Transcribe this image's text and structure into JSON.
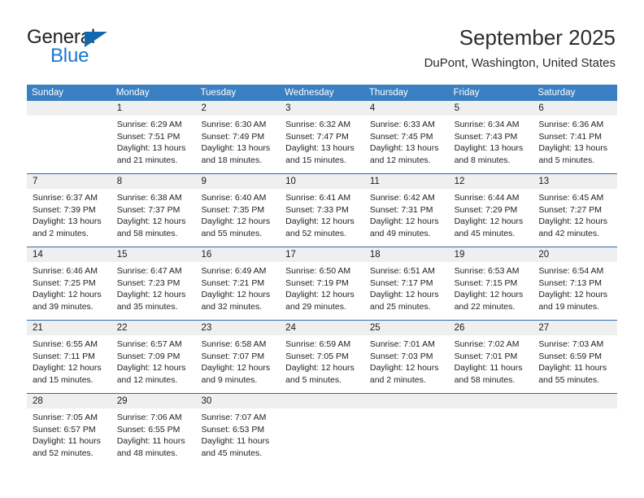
{
  "brand": {
    "name_top": "General",
    "name_bottom": "Blue",
    "accent_color": "#1878cf",
    "triangle_color": "#1267b1"
  },
  "header": {
    "title": "September 2025",
    "subtitle": "DuPont, Washington, United States"
  },
  "theme": {
    "header_row_bg": "#3a7fc1",
    "week_divider": "#2c6ca8",
    "day_number_band": "#efefef"
  },
  "calendar": {
    "weekdays": [
      "Sunday",
      "Monday",
      "Tuesday",
      "Wednesday",
      "Thursday",
      "Friday",
      "Saturday"
    ],
    "weeks": [
      [
        {
          "day": "",
          "lines": []
        },
        {
          "day": "1",
          "lines": [
            "Sunrise: 6:29 AM",
            "Sunset: 7:51 PM",
            "Daylight: 13 hours",
            "and 21 minutes."
          ]
        },
        {
          "day": "2",
          "lines": [
            "Sunrise: 6:30 AM",
            "Sunset: 7:49 PM",
            "Daylight: 13 hours",
            "and 18 minutes."
          ]
        },
        {
          "day": "3",
          "lines": [
            "Sunrise: 6:32 AM",
            "Sunset: 7:47 PM",
            "Daylight: 13 hours",
            "and 15 minutes."
          ]
        },
        {
          "day": "4",
          "lines": [
            "Sunrise: 6:33 AM",
            "Sunset: 7:45 PM",
            "Daylight: 13 hours",
            "and 12 minutes."
          ]
        },
        {
          "day": "5",
          "lines": [
            "Sunrise: 6:34 AM",
            "Sunset: 7:43 PM",
            "Daylight: 13 hours",
            "and 8 minutes."
          ]
        },
        {
          "day": "6",
          "lines": [
            "Sunrise: 6:36 AM",
            "Sunset: 7:41 PM",
            "Daylight: 13 hours",
            "and 5 minutes."
          ]
        }
      ],
      [
        {
          "day": "7",
          "lines": [
            "Sunrise: 6:37 AM",
            "Sunset: 7:39 PM",
            "Daylight: 13 hours",
            "and 2 minutes."
          ]
        },
        {
          "day": "8",
          "lines": [
            "Sunrise: 6:38 AM",
            "Sunset: 7:37 PM",
            "Daylight: 12 hours",
            "and 58 minutes."
          ]
        },
        {
          "day": "9",
          "lines": [
            "Sunrise: 6:40 AM",
            "Sunset: 7:35 PM",
            "Daylight: 12 hours",
            "and 55 minutes."
          ]
        },
        {
          "day": "10",
          "lines": [
            "Sunrise: 6:41 AM",
            "Sunset: 7:33 PM",
            "Daylight: 12 hours",
            "and 52 minutes."
          ]
        },
        {
          "day": "11",
          "lines": [
            "Sunrise: 6:42 AM",
            "Sunset: 7:31 PM",
            "Daylight: 12 hours",
            "and 49 minutes."
          ]
        },
        {
          "day": "12",
          "lines": [
            "Sunrise: 6:44 AM",
            "Sunset: 7:29 PM",
            "Daylight: 12 hours",
            "and 45 minutes."
          ]
        },
        {
          "day": "13",
          "lines": [
            "Sunrise: 6:45 AM",
            "Sunset: 7:27 PM",
            "Daylight: 12 hours",
            "and 42 minutes."
          ]
        }
      ],
      [
        {
          "day": "14",
          "lines": [
            "Sunrise: 6:46 AM",
            "Sunset: 7:25 PM",
            "Daylight: 12 hours",
            "and 39 minutes."
          ]
        },
        {
          "day": "15",
          "lines": [
            "Sunrise: 6:47 AM",
            "Sunset: 7:23 PM",
            "Daylight: 12 hours",
            "and 35 minutes."
          ]
        },
        {
          "day": "16",
          "lines": [
            "Sunrise: 6:49 AM",
            "Sunset: 7:21 PM",
            "Daylight: 12 hours",
            "and 32 minutes."
          ]
        },
        {
          "day": "17",
          "lines": [
            "Sunrise: 6:50 AM",
            "Sunset: 7:19 PM",
            "Daylight: 12 hours",
            "and 29 minutes."
          ]
        },
        {
          "day": "18",
          "lines": [
            "Sunrise: 6:51 AM",
            "Sunset: 7:17 PM",
            "Daylight: 12 hours",
            "and 25 minutes."
          ]
        },
        {
          "day": "19",
          "lines": [
            "Sunrise: 6:53 AM",
            "Sunset: 7:15 PM",
            "Daylight: 12 hours",
            "and 22 minutes."
          ]
        },
        {
          "day": "20",
          "lines": [
            "Sunrise: 6:54 AM",
            "Sunset: 7:13 PM",
            "Daylight: 12 hours",
            "and 19 minutes."
          ]
        }
      ],
      [
        {
          "day": "21",
          "lines": [
            "Sunrise: 6:55 AM",
            "Sunset: 7:11 PM",
            "Daylight: 12 hours",
            "and 15 minutes."
          ]
        },
        {
          "day": "22",
          "lines": [
            "Sunrise: 6:57 AM",
            "Sunset: 7:09 PM",
            "Daylight: 12 hours",
            "and 12 minutes."
          ]
        },
        {
          "day": "23",
          "lines": [
            "Sunrise: 6:58 AM",
            "Sunset: 7:07 PM",
            "Daylight: 12 hours",
            "and 9 minutes."
          ]
        },
        {
          "day": "24",
          "lines": [
            "Sunrise: 6:59 AM",
            "Sunset: 7:05 PM",
            "Daylight: 12 hours",
            "and 5 minutes."
          ]
        },
        {
          "day": "25",
          "lines": [
            "Sunrise: 7:01 AM",
            "Sunset: 7:03 PM",
            "Daylight: 12 hours",
            "and 2 minutes."
          ]
        },
        {
          "day": "26",
          "lines": [
            "Sunrise: 7:02 AM",
            "Sunset: 7:01 PM",
            "Daylight: 11 hours",
            "and 58 minutes."
          ]
        },
        {
          "day": "27",
          "lines": [
            "Sunrise: 7:03 AM",
            "Sunset: 6:59 PM",
            "Daylight: 11 hours",
            "and 55 minutes."
          ]
        }
      ],
      [
        {
          "day": "28",
          "lines": [
            "Sunrise: 7:05 AM",
            "Sunset: 6:57 PM",
            "Daylight: 11 hours",
            "and 52 minutes."
          ]
        },
        {
          "day": "29",
          "lines": [
            "Sunrise: 7:06 AM",
            "Sunset: 6:55 PM",
            "Daylight: 11 hours",
            "and 48 minutes."
          ]
        },
        {
          "day": "30",
          "lines": [
            "Sunrise: 7:07 AM",
            "Sunset: 6:53 PM",
            "Daylight: 11 hours",
            "and 45 minutes."
          ]
        },
        {
          "day": "",
          "lines": []
        },
        {
          "day": "",
          "lines": []
        },
        {
          "day": "",
          "lines": []
        },
        {
          "day": "",
          "lines": []
        }
      ]
    ]
  }
}
